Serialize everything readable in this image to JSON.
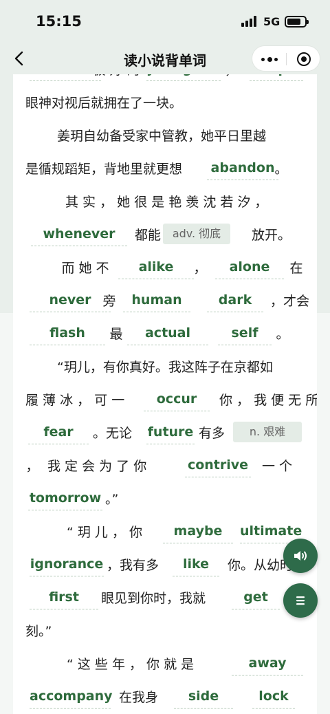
{
  "status_bar": {
    "time": "15:15",
    "network": "5G"
  },
  "nav": {
    "title": "读小说背单词"
  },
  "story": {
    "lines": [
      [
        {
          "k": "w",
          "v": "feature"
        },
        {
          "k": "t",
          "v": "极 好 的"
        },
        {
          "k": "w",
          "v": "youngster"
        },
        {
          "k": "t",
          "v": "，"
        },
        {
          "k": "w",
          "v": "couple"
        }
      ],
      [
        {
          "k": "t",
          "v": "眼神对视后就拥在了一块。"
        }
      ],
      [
        {
          "k": "t",
          "v": "姜玥自幼备受家中管教，她平日里越"
        }
      ],
      [
        {
          "k": "t",
          "v": "是循规蹈矩，背地里就更想"
        },
        {
          "k": "w",
          "v": "abandon"
        },
        {
          "k": "t",
          "v": "。"
        }
      ],
      [
        {
          "k": "t",
          "v": "其 实 ， 她 很 是 艳 羡 沈 若 汐 ，"
        }
      ],
      [
        {
          "k": "w",
          "v": "whenever"
        },
        {
          "k": "t",
          "v": "都能"
        },
        {
          "k": "tip",
          "v": "adv. 彻底"
        },
        {
          "k": "t",
          "v": "放开。"
        }
      ],
      [
        {
          "k": "t",
          "v": "而 她 不"
        },
        {
          "k": "w",
          "v": "alike"
        },
        {
          "k": "t",
          "v": "，"
        },
        {
          "k": "w",
          "v": "alone"
        },
        {
          "k": "t",
          "v": "在"
        }
      ],
      [
        {
          "k": "w",
          "v": "never"
        },
        {
          "k": "t",
          "v": "旁"
        },
        {
          "k": "w",
          "v": "human"
        },
        {
          "k": "w",
          "v": "dark"
        },
        {
          "k": "t",
          "v": "，才会"
        }
      ],
      [
        {
          "k": "w",
          "v": "flash"
        },
        {
          "k": "t",
          "v": "最"
        },
        {
          "k": "w",
          "v": "actual"
        },
        {
          "k": "w",
          "v": "self"
        },
        {
          "k": "t",
          "v": "。"
        }
      ],
      [
        {
          "k": "t",
          "v": "“玥儿，有你真好。我这阵子在京都如"
        }
      ],
      [
        {
          "k": "t",
          "v": "履 薄 冰 ， 可 一"
        },
        {
          "k": "w",
          "v": "occur"
        },
        {
          "k": "t",
          "v": "你 ， 我 便 无 所"
        }
      ],
      [
        {
          "k": "w",
          "v": "fear"
        },
        {
          "k": "t",
          "v": "。无论"
        },
        {
          "k": "w",
          "v": "future"
        },
        {
          "k": "t",
          "v": "有多"
        },
        {
          "k": "tip",
          "v": "n. 艰难"
        }
      ],
      [
        {
          "k": "t",
          "v": "，"
        },
        {
          "k": "t",
          "v": "我 定 会 为 了 你"
        },
        {
          "k": "w",
          "v": "contrive"
        },
        {
          "k": "t",
          "v": "一 个"
        }
      ],
      [
        {
          "k": "w",
          "v": "tomorrow"
        },
        {
          "k": "t",
          "v": "。”"
        }
      ],
      [
        {
          "k": "t",
          "v": "“ 玥 儿 ， 你"
        },
        {
          "k": "w",
          "v": "maybe"
        },
        {
          "k": "w",
          "v": "ultimate"
        }
      ],
      [
        {
          "k": "w",
          "v": "ignorance"
        },
        {
          "k": "t",
          "v": "，我有多"
        },
        {
          "k": "w",
          "v": "like"
        },
        {
          "k": "t",
          "v": "你。从幼时"
        }
      ],
      [
        {
          "k": "w",
          "v": "first"
        },
        {
          "k": "t",
          "v": "眼见到你时，我就"
        },
        {
          "k": "w",
          "v": "get"
        }
      ],
      [
        {
          "k": "t",
          "v": "刻。”"
        }
      ],
      [
        {
          "k": "t",
          "v": "“ 这 些 年 ， 你 就 是"
        },
        {
          "k": "w",
          "v": "away"
        }
      ],
      [
        {
          "k": "w",
          "v": "accompany"
        },
        {
          "k": "t",
          "v": "在我身"
        },
        {
          "k": "w",
          "v": "side"
        },
        {
          "k": "w",
          "v": "lock"
        }
      ]
    ]
  },
  "icons": {
    "audio": "speaker-icon",
    "menu": "list-menu-icon",
    "back": "chevron-left-icon",
    "more": "more-dots-icon",
    "close": "target-circle-icon"
  },
  "colors": {
    "accent": "#2e6b3c",
    "fab": "#2e6b4a",
    "tip_bg": "#e4ece6",
    "page_bg": "#e9efeb"
  }
}
